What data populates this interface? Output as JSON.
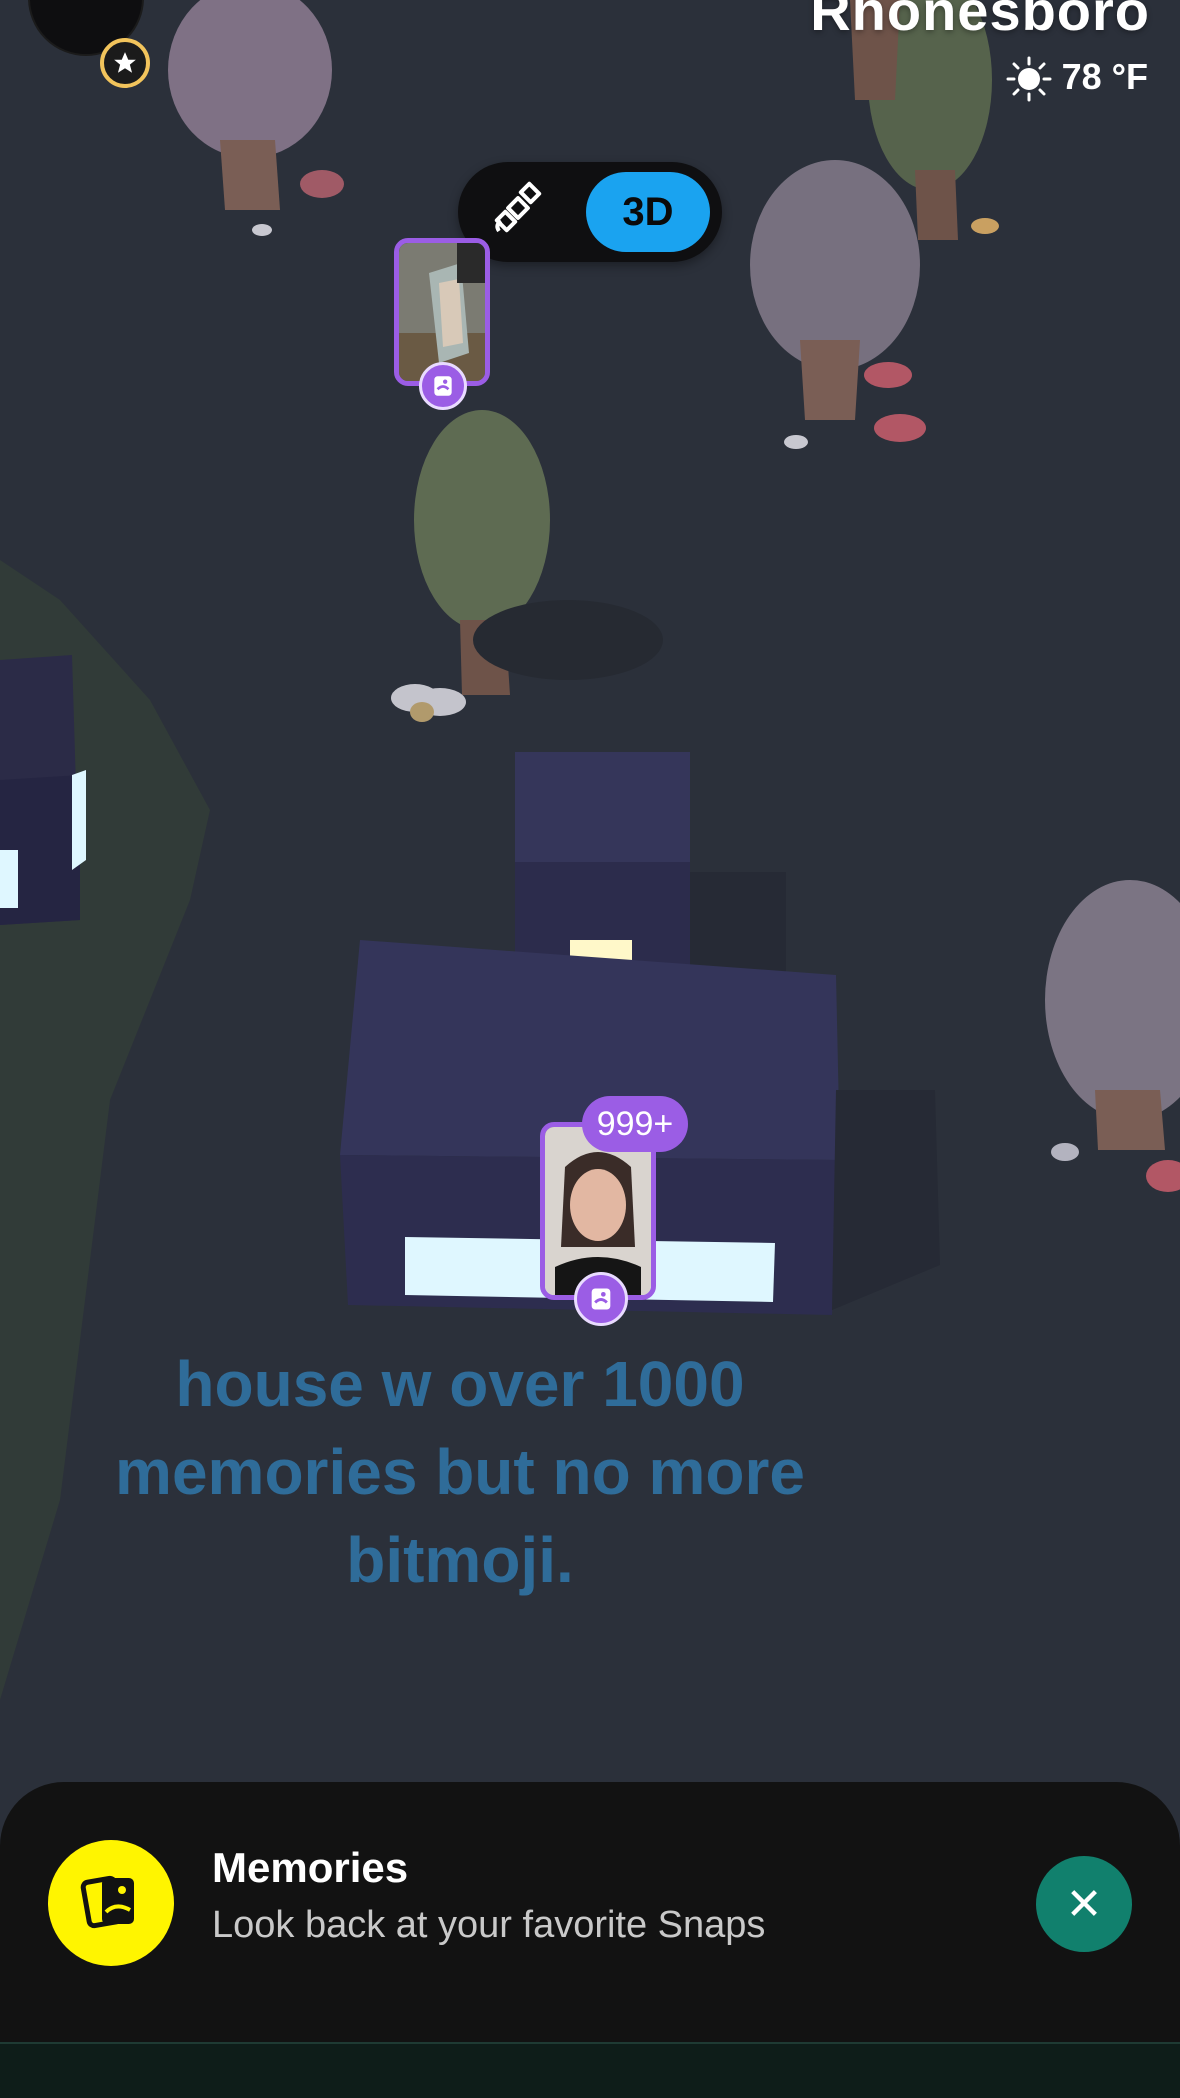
{
  "header": {
    "location_name": "Rhonesboro",
    "weather": {
      "temperature": "78 °F",
      "icon": "sun-icon"
    }
  },
  "view_toggle": {
    "satellite_icon": "satellite-icon",
    "mode_3d_label": "3D"
  },
  "map": {
    "memory_pin_count": "999+",
    "caption": "house w over 1000 memories but no more bitmoji."
  },
  "memories_sheet": {
    "title": "Memories",
    "subtitle": "Look back at your favorite Snaps",
    "icon": "memories-icon",
    "close_icon": "close-icon"
  },
  "colors": {
    "accent_purple": "#9b5de5",
    "toggle_blue": "#1aa3f0",
    "memories_yellow": "#fff500",
    "close_green": "#11806d",
    "caption_blue": "#2f6c99"
  }
}
